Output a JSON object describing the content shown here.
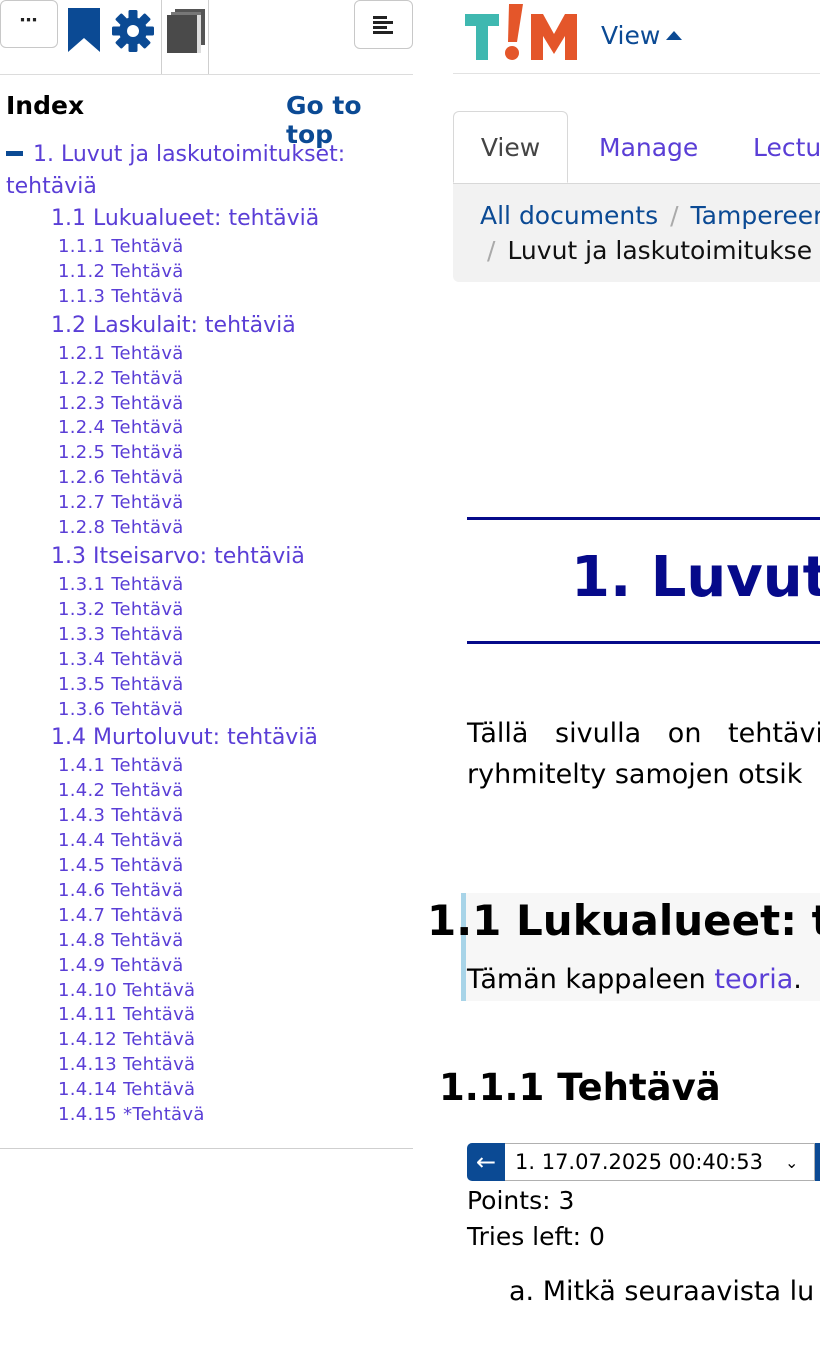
{
  "sidebar": {
    "more_label": "⋯",
    "index_title": "Index",
    "go_to_top": "Go to top",
    "toc": {
      "l1": "1. Luvut ja laskutoimitukset: tehtäviä",
      "sections": [
        {
          "label": "1.1 Lukualueet: tehtäviä",
          "items": [
            "1.1.1 Tehtävä",
            "1.1.2 Tehtävä",
            "1.1.3 Tehtävä"
          ]
        },
        {
          "label": "1.2 Laskulait: tehtäviä",
          "items": [
            "1.2.1 Tehtävä",
            "1.2.2 Tehtävä",
            "1.2.3 Tehtävä",
            "1.2.4 Tehtävä",
            "1.2.5 Tehtävä",
            "1.2.6 Tehtävä",
            "1.2.7 Tehtävä",
            "1.2.8 Tehtävä"
          ]
        },
        {
          "label": "1.3 Itseisarvo: tehtäviä",
          "items": [
            "1.3.1 Tehtävä",
            "1.3.2 Tehtävä",
            "1.3.3 Tehtävä",
            "1.3.4 Tehtävä",
            "1.3.5 Tehtävä",
            "1.3.6 Tehtävä"
          ]
        },
        {
          "label": "1.4 Murtoluvut: tehtäviä",
          "items": [
            "1.4.1 Tehtävä",
            "1.4.2 Tehtävä",
            "1.4.3 Tehtävä",
            "1.4.4 Tehtävä",
            "1.4.5 Tehtävä",
            "1.4.6 Tehtävä",
            "1.4.7 Tehtävä",
            "1.4.8 Tehtävä",
            "1.4.9 Tehtävä",
            "1.4.10 Tehtävä",
            "1.4.11 Tehtävä",
            "1.4.12 Tehtävä",
            "1.4.13 Tehtävä",
            "1.4.14 Tehtävä",
            "1.4.15 *Tehtävä"
          ]
        }
      ]
    }
  },
  "header": {
    "logo_text": "TIM",
    "view_menu": "View"
  },
  "tabs": [
    "View",
    "Manage",
    "Lectu"
  ],
  "breadcrumb": {
    "all_documents": "All documents",
    "second": "Tampereen",
    "current": "Luvut ja laskutoimitukse"
  },
  "content": {
    "h1": "1. Luvut",
    "intro_line1": "Tällä sivulla on tehtävia",
    "intro_line2": "ryhmitelty samojen otsik",
    "section_title": "1.1 Lukualueet: t",
    "section_text": "Tämän kappaleen ",
    "section_link": "teoria",
    "section_after": ".",
    "sub_title": "1.1.1 Tehtävä",
    "prev_arrow": "←",
    "answer_selected": "1. 17.07.2025 00:40:53",
    "points": "Points: 3",
    "tries": "Tries left: 0",
    "question": "a. Mitkä seuraavista lu"
  },
  "colors": {
    "accent": "#0b4a94",
    "link": "#5a3ed6",
    "heading": "#060a8a",
    "logo_teal": "#3fb8b0",
    "logo_orange": "#e4562a"
  }
}
